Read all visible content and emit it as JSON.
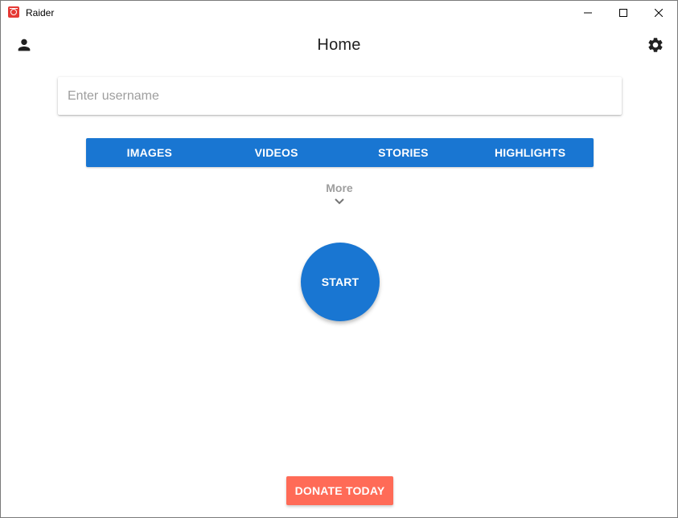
{
  "window": {
    "title": "Raider",
    "icon": "raider-app-icon",
    "controls": [
      "minimize-icon",
      "maximize-icon",
      "close-icon"
    ]
  },
  "appbar": {
    "title": "Home",
    "left_icon": "account-icon",
    "right_icon": "settings-gear-icon"
  },
  "search": {
    "placeholder": "Enter username",
    "value": ""
  },
  "tabs": [
    {
      "label": "IMAGES"
    },
    {
      "label": "VIDEOS"
    },
    {
      "label": "STORIES"
    },
    {
      "label": "HIGHLIGHTS"
    }
  ],
  "more": {
    "label": "More",
    "icon": "chevron-down-icon"
  },
  "start": {
    "label": "START"
  },
  "donate": {
    "label": "DONATE TODAY"
  },
  "colors": {
    "primary": "#1976d2",
    "donate": "#ff6b57",
    "app_icon": "#e53935",
    "muted_text": "#9e9e9e",
    "title_text": "#212121"
  }
}
